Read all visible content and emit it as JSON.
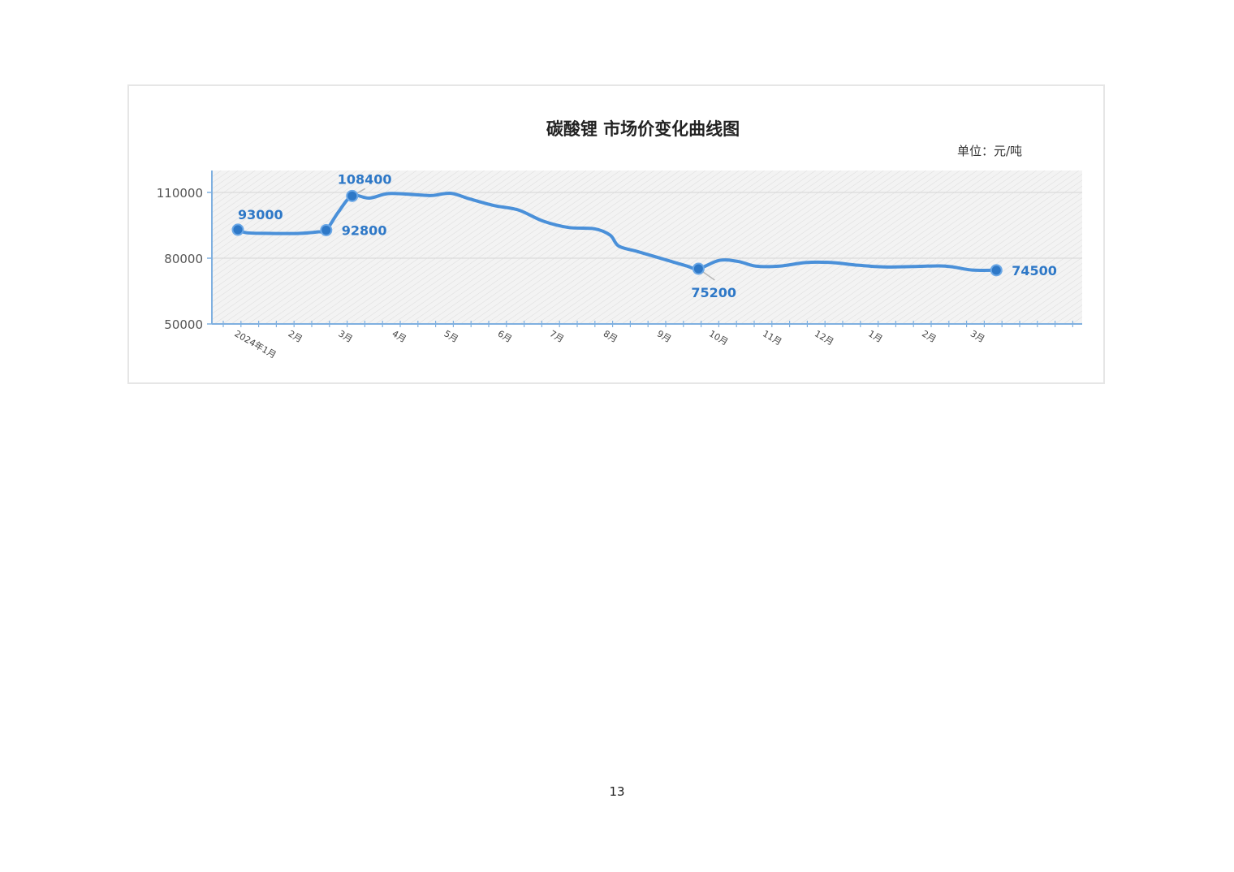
{
  "page": {
    "number": "13"
  },
  "chart_data": {
    "type": "line",
    "title": "碳酸锂 市场价变化曲线图",
    "unit": "单位：元/吨",
    "xlabel": "",
    "ylabel": "",
    "ylim": [
      50000,
      120000
    ],
    "yticks": [
      50000,
      80000,
      110000
    ],
    "ytick_labels": [
      "50000",
      "80000",
      "110000"
    ],
    "grid": true,
    "x_range": [
      "2024-01-01",
      "2025-05-10"
    ],
    "x_tick_labels": [
      {
        "date": "2024-01-01",
        "label": "2024年1月"
      },
      {
        "date": "2024-02-01",
        "label": "2月"
      },
      {
        "date": "2024-03-01",
        "label": "3月"
      },
      {
        "date": "2024-04-01",
        "label": "4月"
      },
      {
        "date": "2024-05-01",
        "label": "5月"
      },
      {
        "date": "2024-06-01",
        "label": "6月"
      },
      {
        "date": "2024-07-01",
        "label": "7月"
      },
      {
        "date": "2024-08-01",
        "label": "8月"
      },
      {
        "date": "2024-09-01",
        "label": "9月"
      },
      {
        "date": "2024-10-01",
        "label": "10月"
      },
      {
        "date": "2024-11-01",
        "label": "11月"
      },
      {
        "date": "2024-12-01",
        "label": "12月"
      },
      {
        "date": "2025-01-01",
        "label": "1月"
      },
      {
        "date": "2025-02-01",
        "label": "2月"
      },
      {
        "date": "2025-03-01",
        "label": "3月"
      }
    ],
    "series": [
      {
        "color": "#4a90d9",
        "points": [
          {
            "x": "2024-01-01",
            "y": 93000
          },
          {
            "x": "2024-01-06",
            "y": 91600
          },
          {
            "x": "2024-01-20",
            "y": 91300
          },
          {
            "x": "2024-02-05",
            "y": 91300
          },
          {
            "x": "2024-02-16",
            "y": 92000
          },
          {
            "x": "2024-02-21",
            "y": 92800
          },
          {
            "x": "2024-02-28",
            "y": 101000
          },
          {
            "x": "2024-03-07",
            "y": 108400
          },
          {
            "x": "2024-03-17",
            "y": 107400
          },
          {
            "x": "2024-03-28",
            "y": 109500
          },
          {
            "x": "2024-04-12",
            "y": 109000
          },
          {
            "x": "2024-04-22",
            "y": 108600
          },
          {
            "x": "2024-05-03",
            "y": 109600
          },
          {
            "x": "2024-05-14",
            "y": 107000
          },
          {
            "x": "2024-05-28",
            "y": 104000
          },
          {
            "x": "2024-06-11",
            "y": 102000
          },
          {
            "x": "2024-06-25",
            "y": 97000
          },
          {
            "x": "2024-07-10",
            "y": 94000
          },
          {
            "x": "2024-07-25",
            "y": 93400
          },
          {
            "x": "2024-08-03",
            "y": 90500
          },
          {
            "x": "2024-08-08",
            "y": 85500
          },
          {
            "x": "2024-08-19",
            "y": 83000
          },
          {
            "x": "2024-09-03",
            "y": 79500
          },
          {
            "x": "2024-09-16",
            "y": 76500
          },
          {
            "x": "2024-09-23",
            "y": 75200
          },
          {
            "x": "2024-10-05",
            "y": 79000
          },
          {
            "x": "2024-10-16",
            "y": 78500
          },
          {
            "x": "2024-10-26",
            "y": 76400
          },
          {
            "x": "2024-11-09",
            "y": 76400
          },
          {
            "x": "2024-11-24",
            "y": 78000
          },
          {
            "x": "2024-12-09",
            "y": 78000
          },
          {
            "x": "2024-12-24",
            "y": 76800
          },
          {
            "x": "2025-01-08",
            "y": 76000
          },
          {
            "x": "2025-01-25",
            "y": 76200
          },
          {
            "x": "2025-02-09",
            "y": 76500
          },
          {
            "x": "2025-02-17",
            "y": 76000
          },
          {
            "x": "2025-02-28",
            "y": 74600
          },
          {
            "x": "2025-03-14",
            "y": 74500
          }
        ]
      }
    ],
    "markers": [
      {
        "x": "2024-01-01",
        "y": 93000,
        "label": "93000"
      },
      {
        "x": "2024-02-21",
        "y": 92800,
        "label": "92800"
      },
      {
        "x": "2024-03-07",
        "y": 108400,
        "label": "108400"
      },
      {
        "x": "2024-09-23",
        "y": 75200,
        "label": "75200"
      },
      {
        "x": "2025-03-14",
        "y": 74500,
        "label": "74500"
      }
    ]
  }
}
